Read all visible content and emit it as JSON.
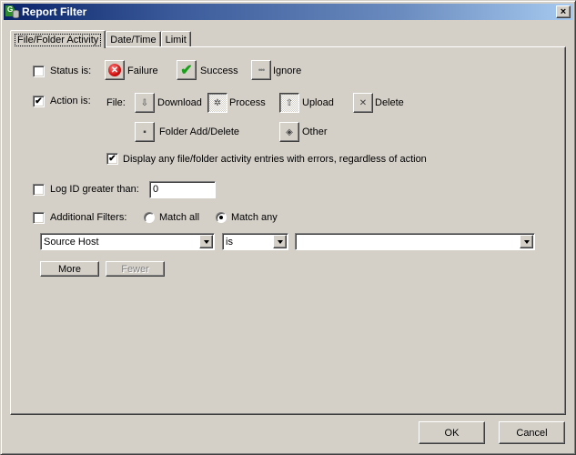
{
  "window": {
    "title": "Report Filter",
    "close_glyph": "×"
  },
  "tabs": [
    {
      "label": "File/Folder Activity",
      "active": true
    },
    {
      "label": "Date/Time",
      "active": false
    },
    {
      "label": "Limit",
      "active": false
    }
  ],
  "status": {
    "label": "Status is:",
    "checked": false,
    "options": [
      {
        "label": "Failure",
        "icon": "failure-icon",
        "pressed": false
      },
      {
        "label": "Success",
        "icon": "success-icon",
        "pressed": false
      },
      {
        "label": "Ignore",
        "icon": "ignore-icon",
        "pressed": false
      }
    ]
  },
  "action": {
    "label": "Action is:",
    "checked": true,
    "file_label": "File:",
    "options": [
      {
        "label": "Download",
        "icon": "download-arrow-icon",
        "pressed": false
      },
      {
        "label": "Process",
        "icon": "process-gear-icon",
        "pressed": true
      },
      {
        "label": "Upload",
        "icon": "upload-arrow-icon",
        "pressed": true
      },
      {
        "label": "Delete",
        "icon": "delete-x-icon",
        "pressed": false
      },
      {
        "label": "Folder Add/Delete",
        "icon": "folder-icon",
        "pressed": false
      },
      {
        "label": "Other",
        "icon": "other-diamond-icon",
        "pressed": false
      }
    ],
    "errors_label": "Display any file/folder activity entries with errors, regardless of action",
    "errors_checked": true
  },
  "log_id": {
    "label": "Log ID greater than:",
    "checked": false,
    "value": "0"
  },
  "additional": {
    "label": "Additional Filters:",
    "checked": false,
    "match_all_label": "Match all",
    "match_any_label": "Match any",
    "selected": "Match any",
    "field_value": "Source Host",
    "operator_value": "is",
    "criteria_value": ""
  },
  "buttons": {
    "more": "More",
    "fewer": "Fewer",
    "ok": "OK",
    "cancel": "Cancel"
  },
  "glyphs": {
    "check": "✔",
    "failure": "✕",
    "success": "✔",
    "ignore": "•••",
    "download": "⇩",
    "process": "✲",
    "upload": "⇧",
    "delete": "✕",
    "folder": "▪",
    "other": "◈"
  }
}
